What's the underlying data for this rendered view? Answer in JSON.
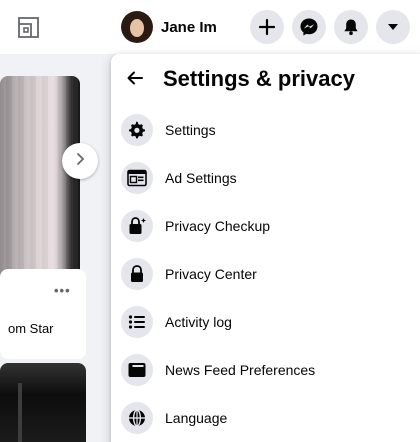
{
  "topbar": {
    "profile_name": "Jane Im",
    "create_icon": "plus-icon",
    "messenger_icon": "messenger-icon",
    "notifications_icon": "bell-icon",
    "account_icon": "caret-down-icon"
  },
  "feed": {
    "post_menu": "•••",
    "post_snippet": "om Star"
  },
  "panel": {
    "title": "Settings & privacy",
    "items": [
      {
        "label": "Settings",
        "icon": "gear-icon"
      },
      {
        "label": "Ad Settings",
        "icon": "ad-settings-icon"
      },
      {
        "label": "Privacy Checkup",
        "icon": "lock-sparkle-icon"
      },
      {
        "label": "Privacy Center",
        "icon": "lock-icon"
      },
      {
        "label": "Activity log",
        "icon": "list-icon"
      },
      {
        "label": "News Feed Preferences",
        "icon": "feed-icon"
      },
      {
        "label": "Language",
        "icon": "globe-icon"
      }
    ]
  },
  "colors": {
    "page_bg": "#f0f2f5",
    "button_bg": "#e4e6eb",
    "text": "#050505",
    "secondary_text": "#65676b"
  }
}
